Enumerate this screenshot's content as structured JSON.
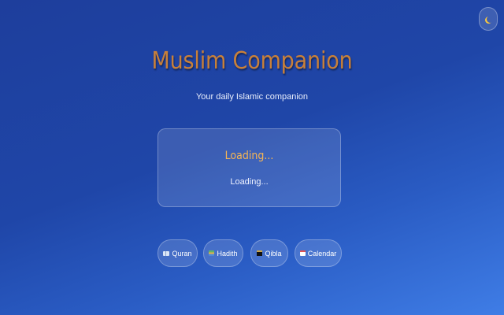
{
  "header": {
    "title": "Muslim Companion",
    "subtitle": "Your daily Islamic companion",
    "theme_toggle_icon": "moon-icon"
  },
  "status_card": {
    "title": "Loading...",
    "text": "Loading..."
  },
  "nav": [
    {
      "label": "Quran",
      "icon": "book-icon"
    },
    {
      "label": "Hadith",
      "icon": "books-icon"
    },
    {
      "label": "Qibla",
      "icon": "kaaba-icon"
    },
    {
      "label": "Calendar",
      "icon": "calendar-icon"
    }
  ],
  "colors": {
    "title": "#c8803a",
    "card_title": "#f5b555",
    "background_start": "#1e3e9c",
    "background_end": "#3f7de6"
  }
}
